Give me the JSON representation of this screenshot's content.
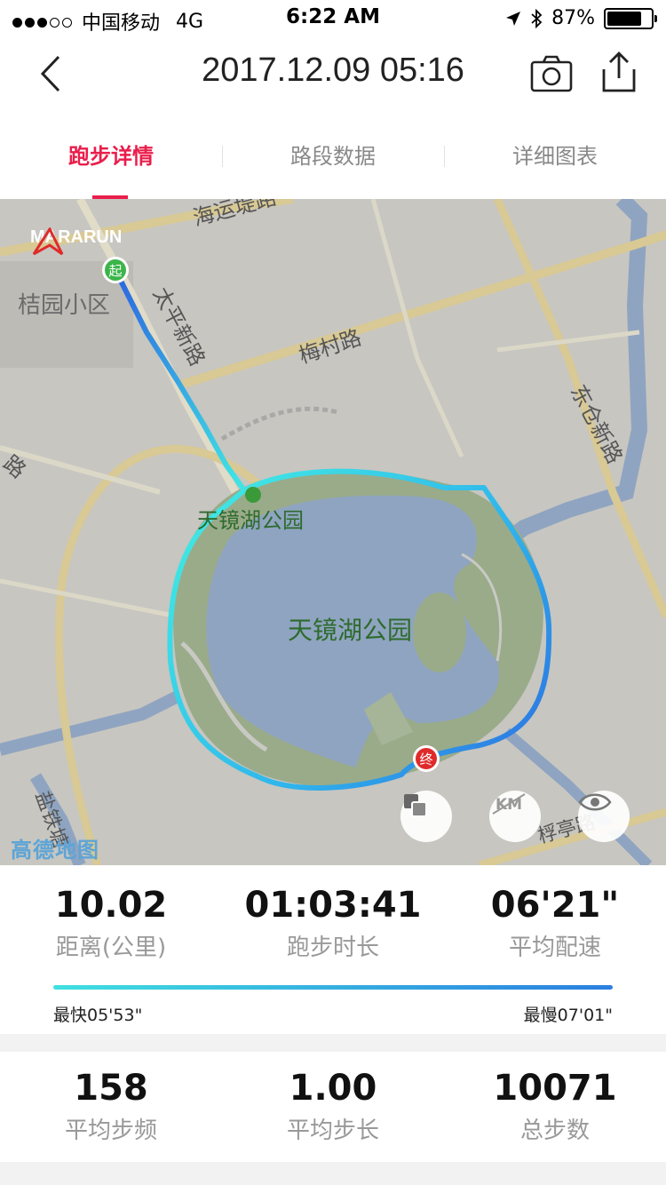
{
  "status_bar": {
    "carrier": "中国移动",
    "network": "4G",
    "time": "6:22 AM",
    "battery": "87%",
    "battery_level": 0.87
  },
  "header": {
    "title": "2017.12.09 05:16"
  },
  "tabs": [
    {
      "label": "跑步详情",
      "active": true
    },
    {
      "label": "路段数据",
      "active": false
    },
    {
      "label": "详细图表",
      "active": false
    }
  ],
  "map": {
    "brand": "MARARUN",
    "start_marker": "起",
    "end_marker": "终",
    "provider": "高德地图",
    "labels": {
      "haiyun": "海运堤路",
      "jieyuan": "桔园小区",
      "taiping": "太平新路",
      "meicun": "梅村路",
      "dongcang": "东仓新路",
      "park_upper": "天镜湖公园",
      "park_center": "天镜湖公园",
      "yantie": "盐铁塘",
      "yuting": "桴亭路",
      "lu_left": "路"
    },
    "buttons": {
      "layers_icon": "layers-icon",
      "km_icon": "km-toggle-icon",
      "eye_icon": "eye-icon"
    },
    "colors": {
      "route_start": "#2c64e0",
      "route_mid": "#3ee6e6",
      "water": "#8fa4c0",
      "park": "#9aab8a"
    }
  },
  "summary": {
    "distance": {
      "value": "10.02",
      "label": "距离(公里)"
    },
    "duration": {
      "value": "01:03:41",
      "label": "跑步时长"
    },
    "pace": {
      "value": "06'21\"",
      "label": "平均配速"
    },
    "fastest": "最快05'53\"",
    "slowest": "最慢07'01\""
  },
  "details": {
    "cadence": {
      "value": "158",
      "label": "平均步频"
    },
    "stride": {
      "value": "1.00",
      "label": "平均步长"
    },
    "steps": {
      "value": "10071",
      "label": "总步数"
    }
  }
}
